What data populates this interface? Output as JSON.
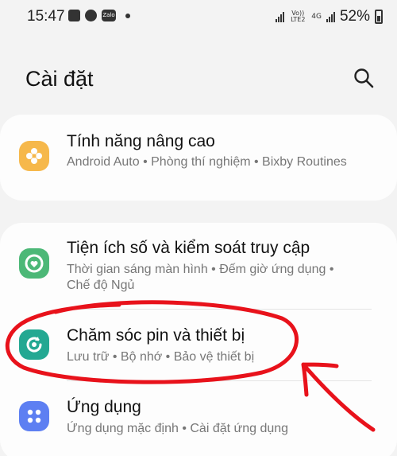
{
  "status_bar": {
    "time": "15:47",
    "notification_icons": [
      "gallery-icon",
      "messenger-icon",
      "zalo-icon"
    ],
    "zalo_label": "Zalo",
    "volte_label": "Vo)) LTE2",
    "network_label": "4G",
    "battery_percent": "52%"
  },
  "header": {
    "title": "Cài đặt",
    "search_icon": "search-icon"
  },
  "settings": [
    {
      "title": "Tính năng nâng cao",
      "subtitle": "Android Auto  •  Phòng thí nghiệm  •  Bixby Routines",
      "icon": "advanced-features-icon",
      "icon_color": "#f6b84b"
    },
    {
      "title": "Tiện ích số và kiểm soát truy cập",
      "subtitle": "Thời gian sáng màn hình  •  Đếm giờ ứng dụng  •  Chế độ Ngủ",
      "icon": "digital-wellbeing-icon",
      "icon_color": "#4cb877"
    },
    {
      "title": "Chăm sóc pin và thiết bị",
      "subtitle": "Lưu trữ  •  Bộ nhớ  •  Bảo vệ thiết bị",
      "icon": "device-care-icon",
      "icon_color": "#23a892"
    },
    {
      "title": "Ứng dụng",
      "subtitle": "Ứng dụng mặc định  •  Cài đặt ứng dụng",
      "icon": "apps-icon",
      "icon_color": "#5d7ff2"
    }
  ],
  "annotation_color": "#e8121b"
}
